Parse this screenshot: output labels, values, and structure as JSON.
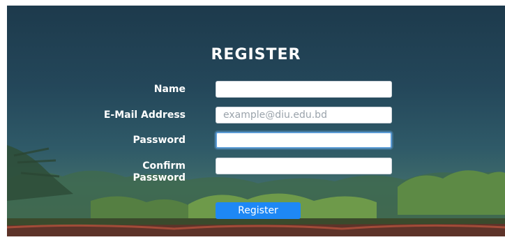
{
  "form": {
    "title": "REGISTER",
    "name_label": "Name",
    "name_value": "",
    "email_label": "E-Mail Address",
    "email_placeholder": "example@diu.edu.bd",
    "password_label": "Password",
    "password_value": "",
    "confirm_label_line1": "Confirm",
    "confirm_label_line2": "Password",
    "confirm_value": "",
    "submit_label": "Register"
  },
  "colors": {
    "background_top": "#1d3a4c",
    "button": "#1e88f5",
    "focus_ring": "#5b9bd5"
  }
}
